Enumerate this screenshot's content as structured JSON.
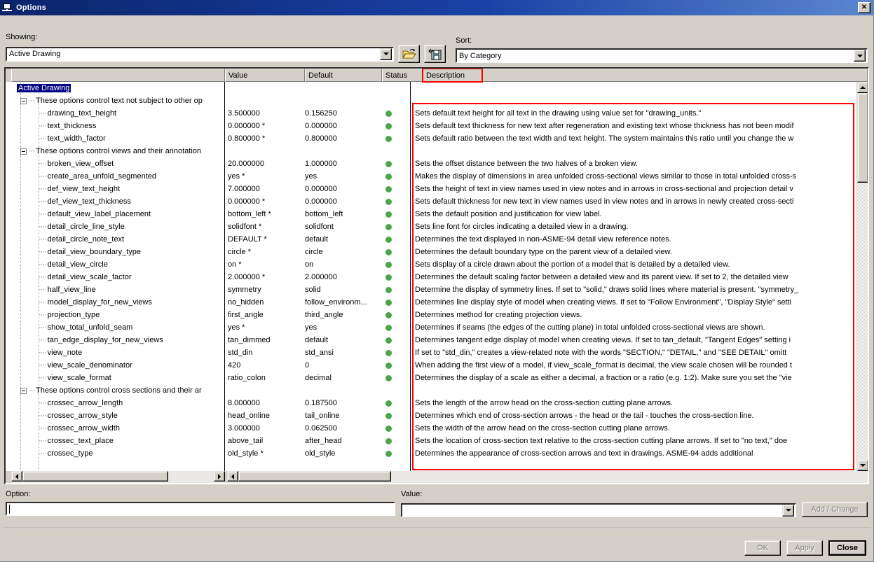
{
  "window": {
    "title": "Options",
    "close_label": "✕",
    "icon": "options-window-icon"
  },
  "toolbar": {
    "showing_label": "Showing:",
    "showing_value": "Active Drawing",
    "sort_label": "Sort:",
    "sort_value": "By Category",
    "open_button_title": "open-folder",
    "save_button_title": "save-file"
  },
  "columns": {
    "blank": "",
    "value": "Value",
    "default": "Default",
    "status": "Status",
    "description": "Description",
    "description_highlight_color": "#ff0000"
  },
  "rows": [
    {
      "type": "root",
      "name": "Active Drawing",
      "value": "",
      "default": "",
      "status": false,
      "description": ""
    },
    {
      "type": "group",
      "name": "These options control text not subject to other op",
      "value": "",
      "default": "",
      "status": false,
      "description": ""
    },
    {
      "type": "leaf",
      "name": "drawing_text_height",
      "value": "3.500000",
      "default": "0.156250",
      "status": true,
      "description": "Sets default text height for all text in the drawing using value set for \"drawing_units.\""
    },
    {
      "type": "leaf",
      "name": "text_thickness",
      "value": "0.000000 *",
      "default": "0.000000",
      "status": true,
      "description": "Sets default text thickness for new text after regeneration and existing text whose thickness has not been modif"
    },
    {
      "type": "leaf",
      "name": "text_width_factor",
      "value": "0.800000 *",
      "default": "0.800000",
      "status": true,
      "description": "Sets default ratio between the text width and text height. The system maintains this ratio until you change the w"
    },
    {
      "type": "group",
      "name": "These options control views and their annotation",
      "value": "",
      "default": "",
      "status": false,
      "description": ""
    },
    {
      "type": "leaf",
      "name": "broken_view_offset",
      "value": "20.000000",
      "default": "1.000000",
      "status": true,
      "description": "Sets the offset distance between the two halves of a broken view."
    },
    {
      "type": "leaf",
      "name": "create_area_unfold_segmented",
      "value": "yes *",
      "default": "yes",
      "status": true,
      "description": "Makes the display of dimensions in area unfolded cross-sectional views similar to those in total unfolded cross-s"
    },
    {
      "type": "leaf",
      "name": "def_view_text_height",
      "value": "7.000000",
      "default": "0.000000",
      "status": true,
      "description": "Sets the height of text in view names used in view notes and in arrows in cross-sectional and projection detail v"
    },
    {
      "type": "leaf",
      "name": "def_view_text_thickness",
      "value": "0.000000 *",
      "default": "0.000000",
      "status": true,
      "description": "Sets default thickness for new text in view names used in view notes and in arrows in newly created cross-secti"
    },
    {
      "type": "leaf",
      "name": "default_view_label_placement",
      "value": "bottom_left *",
      "default": "bottom_left",
      "status": true,
      "description": "Sets the default position and justification for view label."
    },
    {
      "type": "leaf",
      "name": "detail_circle_line_style",
      "value": "solidfont *",
      "default": "solidfont",
      "status": true,
      "description": "Sets line font for circles indicating a detailed view in a drawing."
    },
    {
      "type": "leaf",
      "name": "detail_circle_note_text",
      "value": "DEFAULT *",
      "default": "default",
      "status": true,
      "description": "Determines the text displayed in non-ASME-94 detail view reference notes."
    },
    {
      "type": "leaf",
      "name": "detail_view_boundary_type",
      "value": "circle *",
      "default": "circle",
      "status": true,
      "description": "Determines the default boundary type on the parent view of a detailed view."
    },
    {
      "type": "leaf",
      "name": "detail_view_circle",
      "value": "on *",
      "default": "on",
      "status": true,
      "description": "Sets display of a circle drawn about the portion of a model that is detailed by a detailed view."
    },
    {
      "type": "leaf",
      "name": "detail_view_scale_factor",
      "value": "2.000000 *",
      "default": "2.000000",
      "status": true,
      "description": "Determines the default scaling factor between a detailed view and its parent view. If set to 2, the detailed view"
    },
    {
      "type": "leaf",
      "name": "half_view_line",
      "value": "symmetry",
      "default": "solid",
      "status": true,
      "description": "Determine the display of symmetry lines. If set to \"solid,\" draws solid lines where material is present. \"symmetry_"
    },
    {
      "type": "leaf",
      "name": "model_display_for_new_views",
      "value": "no_hidden",
      "default": "follow_environm...",
      "status": true,
      "description": "Determines line display style of model when creating views. If set to \"Follow Environment\", \"Display Style\" setti"
    },
    {
      "type": "leaf",
      "name": "projection_type",
      "value": "first_angle",
      "default": "third_angle",
      "status": true,
      "description": "Determines method for creating projection views."
    },
    {
      "type": "leaf",
      "name": "show_total_unfold_seam",
      "value": "yes *",
      "default": "yes",
      "status": true,
      "description": "Determines if seams (the edges of the cutting plane) in total unfolded cross-sectional views are shown."
    },
    {
      "type": "leaf",
      "name": "tan_edge_display_for_new_views",
      "value": "tan_dimmed",
      "default": "default",
      "status": true,
      "description": "Determines tangent edge display of model when creating views. If set to tan_default, \"Tangent Edges\" setting i"
    },
    {
      "type": "leaf",
      "name": "view_note",
      "value": "std_din",
      "default": "std_ansi",
      "status": true,
      "description": "If set to \"std_din,\" creates a view-related note with the words \"SECTION,\" \"DETAIL,\" and \"SEE DETAIL\" omitt"
    },
    {
      "type": "leaf",
      "name": "view_scale_denominator",
      "value": "420",
      "default": "0",
      "status": true,
      "description": "When adding the first view of a model, if view_scale_format is decimal, the view scale chosen will be rounded t"
    },
    {
      "type": "leaf",
      "name": "view_scale_format",
      "value": "ratio_colon",
      "default": "decimal",
      "status": true,
      "description": "Determines the display of a scale as either a decimal, a fraction or a ratio (e.g. 1:2). Make sure you set the \"vie"
    },
    {
      "type": "group",
      "name": "These options control cross sections and their ar",
      "value": "",
      "default": "",
      "status": false,
      "description": ""
    },
    {
      "type": "leaf",
      "name": "crossec_arrow_length",
      "value": "8.000000",
      "default": "0.187500",
      "status": true,
      "description": "Sets the length of the arrow head on the cross-section cutting plane arrows."
    },
    {
      "type": "leaf",
      "name": "crossec_arrow_style",
      "value": "head_online",
      "default": "tail_online",
      "status": true,
      "description": "Determines which end of cross-section arrows - the head or the tail - touches the cross-section line."
    },
    {
      "type": "leaf",
      "name": "crossec_arrow_width",
      "value": "3.000000",
      "default": "0.062500",
      "status": true,
      "description": "Sets the width of the arrow head on the cross-section cutting plane arrows."
    },
    {
      "type": "leaf",
      "name": "crossec_text_place",
      "value": "above_tail",
      "default": "after_head",
      "status": true,
      "description": "Sets the location of cross-section text relative to the cross-section cutting plane arrows. If set to \"no text,\" doe"
    },
    {
      "type": "leaf",
      "name": "crossec_type",
      "value": "old_style *",
      "default": "old_style",
      "status": true,
      "description": "Determines the appearance of cross-section arrows and text in drawings. ASME-94 adds additional"
    }
  ],
  "editor": {
    "option_label": "Option:",
    "option_value": "",
    "option_placeholder": "",
    "value_label": "Value:",
    "value_value": "",
    "value_placeholder": "",
    "add_change_label": "Add / Change"
  },
  "footer": {
    "ok_label": "OK",
    "apply_label": "Apply",
    "close_label": "Close"
  }
}
